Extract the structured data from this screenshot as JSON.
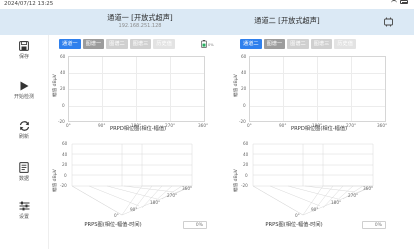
{
  "status": {
    "time": "2024/07/12 13:25"
  },
  "header": {
    "ch1_title": "通道一 [开放式超声]",
    "ch1_ip": "192.168.251.128",
    "ch2_title": "通道二 [开放式超声]"
  },
  "sidebar": [
    {
      "label": "保存",
      "icon": "save-icon"
    },
    {
      "label": "开始检测",
      "icon": "play-icon"
    },
    {
      "label": "刷新",
      "icon": "refresh-icon"
    },
    {
      "label": "数据",
      "icon": "data-icon"
    },
    {
      "label": "设置",
      "icon": "settings-icon"
    }
  ],
  "toolbar_left": [
    "通道一",
    "图谱一",
    "图谱二",
    "图谱三",
    "历史值"
  ],
  "toolbar_right": [
    "通道二",
    "图谱一",
    "图谱二",
    "图谱三",
    "历史值"
  ],
  "prpd": {
    "ylabel": "幅值 dBμV",
    "xlabel": "PRPD相位图(相位-幅值)",
    "yticks": [
      "60",
      "40",
      "20",
      "0",
      "-20"
    ],
    "xticks": [
      "0°",
      "90°",
      "180°",
      "270°",
      "360°"
    ]
  },
  "prps": {
    "ylabel": "幅值 dBμV",
    "xlabel": "PRPS图(相位-幅值-时间)",
    "zticks": [
      "60",
      "40",
      "20",
      "0",
      "-20"
    ],
    "phase_ticks": [
      "0°",
      "90°",
      "180°",
      "270°",
      "360°"
    ],
    "cycle_ticks": [
      "0",
      "10",
      "20",
      "30",
      "40",
      "50"
    ]
  },
  "progress_left": {
    "label": "0%",
    "value": 0
  },
  "progress_right": {
    "label": "0%",
    "value": 0
  }
}
